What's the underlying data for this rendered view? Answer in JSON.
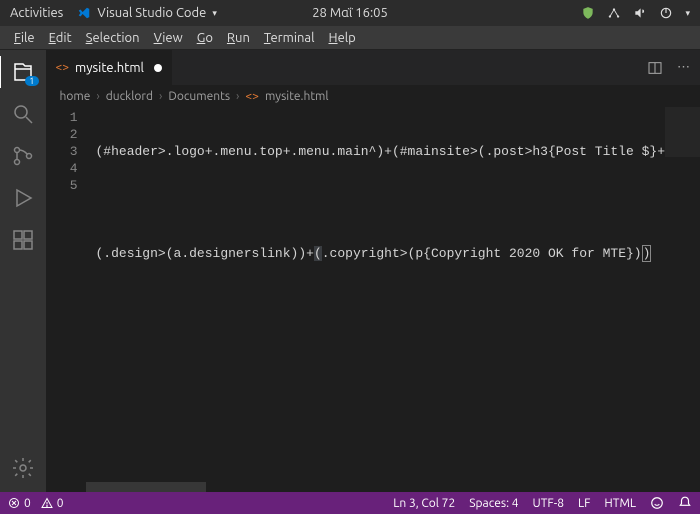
{
  "gnome": {
    "activities": "Activities",
    "app_name": "Visual Studio Code",
    "clock": "28 Μαΐ 16:05"
  },
  "menubar": {
    "file": "File",
    "edit": "Edit",
    "selection": "Selection",
    "view": "View",
    "go": "Go",
    "run": "Run",
    "terminal": "Terminal",
    "help": "Help"
  },
  "tab": {
    "filename": "mysite.html"
  },
  "breadcrumbs": {
    "items": [
      "home",
      "ducklord",
      "Documents",
      "mysite.html"
    ]
  },
  "activity": {
    "explorer_badge": "1"
  },
  "code": {
    "line1": "(#header>.logo+.menu.top+.menu.main^)+(#mainsite>(.post>h3{Post Title $}+",
    "line2": "",
    "line3_pre": "(.design>(a.designerslink))+",
    "line3_hl": "(",
    "line3_mid": ".copyright>(p{Copyright 2020 OK for MTE})",
    "line3_end": ")",
    "line4": "",
    "line5": "",
    "linenums": [
      "1",
      "2",
      "3",
      "4",
      "5"
    ]
  },
  "status": {
    "errors": "0",
    "warnings": "0",
    "position": "Ln 3, Col 72",
    "spaces": "Spaces: 4",
    "encoding": "UTF-8",
    "eol": "LF",
    "lang": "HTML"
  }
}
